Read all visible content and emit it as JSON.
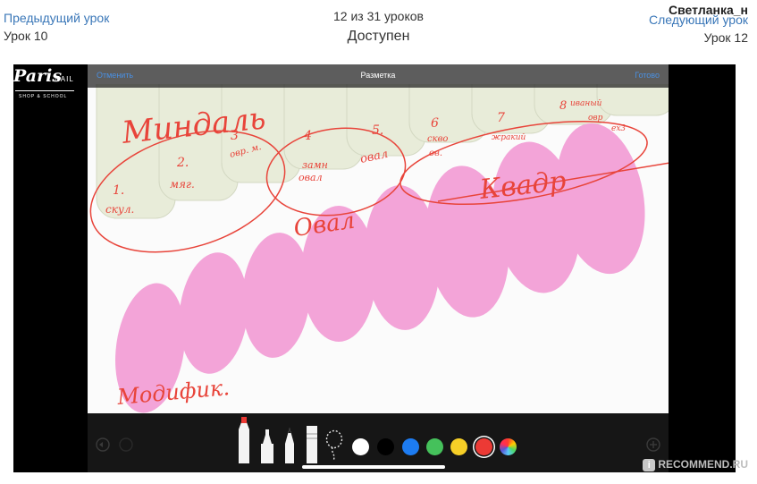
{
  "nav": {
    "prev_link": "Предыдущий урок",
    "prev_lesson": "Урок 10",
    "progress": "12 из 31 уроков",
    "status": "Доступен",
    "next_link": "Следующий урок",
    "next_lesson": "Урок 12",
    "username": "Светланка_н"
  },
  "screenshot": {
    "markup_bar": {
      "cancel": "Отменить",
      "title": "Разметка",
      "done": "Готово"
    },
    "logo": {
      "main": "Paris",
      "nail": "NAIL",
      "sub": "SHOP & SCHOOL"
    },
    "annotations": {
      "mindal": "Миндаль",
      "l1a": "1.",
      "l1b": "скул.",
      "l2a": "2.",
      "l2b": "мяг.",
      "l3a": "3",
      "l3b": "овр. м.",
      "l4a": "4",
      "l4b": "замн",
      "l4c": "овал",
      "l5a": "5.",
      "l5b": "овал",
      "l6a": "6",
      "l6b": "сквo",
      "l6c": "ов.",
      "l7a": "7",
      "l7b": "жракий",
      "l8a": "8",
      "l8b": "иваный",
      "l8c": "овр",
      "l8d": "ex3",
      "oval": "Овал",
      "kvadr": "Квадр",
      "modif": "Модифик."
    },
    "colors": {
      "tip": "#e8ecd9",
      "nail": "#f3a4d8",
      "ink": "#e8443a"
    },
    "tools": [
      "pen-tool",
      "marker-tool",
      "pencil-tool",
      "eraser-tool",
      "lasso-tool"
    ],
    "palette": [
      "#ffffff",
      "#000000",
      "#1d7cf2",
      "#45c15b",
      "#f6cf27",
      "#ec3a35",
      "rainbow"
    ]
  },
  "watermark": "RECOMMEND.RU"
}
